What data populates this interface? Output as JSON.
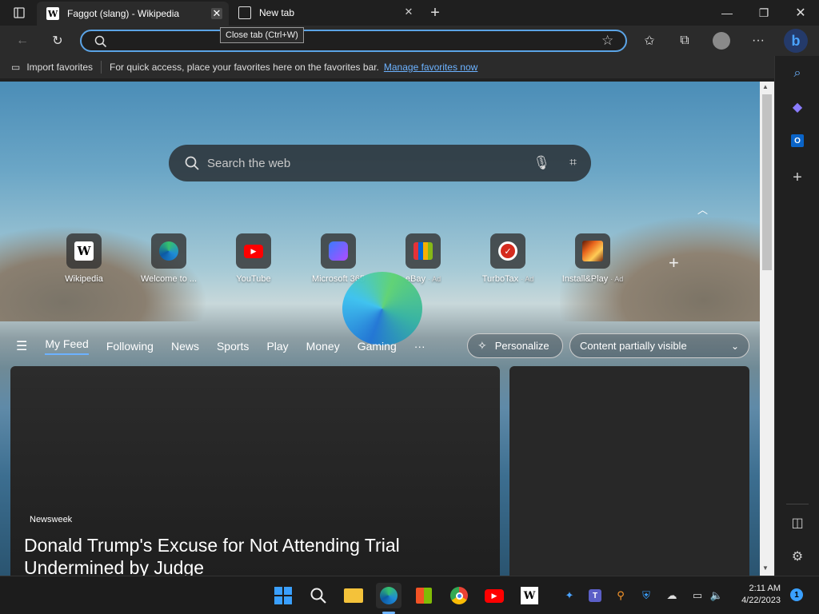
{
  "tabs": [
    {
      "title": "Faggot (slang) - Wikipedia",
      "favicon": "W"
    },
    {
      "title": "New tab"
    }
  ],
  "tooltip": "Close tab (Ctrl+W)",
  "favorites_bar": {
    "import_label": "Import favorites",
    "message": "For quick access, place your favorites here on the favorites bar.",
    "link": "Manage favorites now"
  },
  "search": {
    "placeholder": "Search the web"
  },
  "tiles": [
    {
      "label": "Wikipedia",
      "ad": ""
    },
    {
      "label": "Welcome to ...",
      "ad": ""
    },
    {
      "label": "YouTube",
      "ad": ""
    },
    {
      "label": "Microsoft 365",
      "ad": ""
    },
    {
      "label": "eBay",
      "ad": "· Ad"
    },
    {
      "label": "TurboTax",
      "ad": "· Ad"
    },
    {
      "label": "Install&Play",
      "ad": "· Ad"
    }
  ],
  "feed_nav": [
    "My Feed",
    "Following",
    "News",
    "Sports",
    "Play",
    "Money",
    "Gaming",
    "···"
  ],
  "personalize_label": "Personalize",
  "content_select": "Content partially visible",
  "article": {
    "source": "Newsweek",
    "headline": "Donald Trump's Excuse for Not Attending Trial Undermined by Judge"
  },
  "clock": {
    "time": "2:11 AM",
    "date": "4/22/2023"
  },
  "notification_count": "1",
  "colors": {
    "accent": "#5ba4e6",
    "link": "#6cb2ff",
    "youtube": "#ff0000",
    "turbotax": "#d52b1e"
  }
}
